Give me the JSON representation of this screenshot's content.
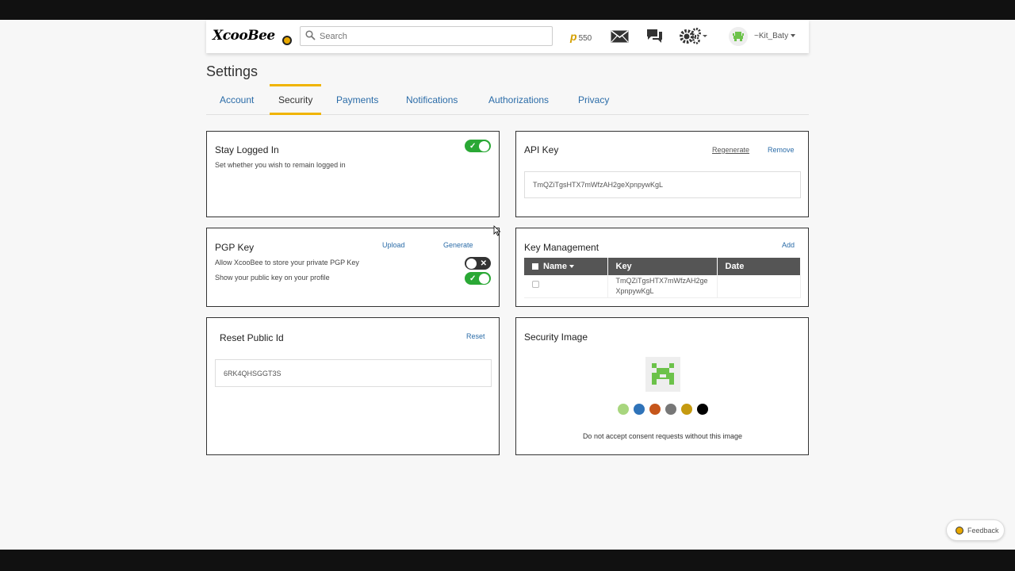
{
  "header": {
    "logo_text": "XcooBee",
    "search_placeholder": "Search",
    "points_symbol": "p",
    "points_value": "550",
    "username": "~Kit_Baty",
    "icons": [
      "search-icon",
      "mail-icon",
      "chat-icon",
      "gears-icon",
      "avatar-icon"
    ]
  },
  "page": {
    "title": "Settings"
  },
  "tabs": [
    {
      "label": "Account"
    },
    {
      "label": "Security"
    },
    {
      "label": "Payments"
    },
    {
      "label": "Notifications"
    },
    {
      "label": "Authorizations"
    },
    {
      "label": "Privacy"
    }
  ],
  "active_tab": "Security",
  "stay_logged_in": {
    "title": "Stay Logged In",
    "subtitle": "Set whether you wish to remain logged in",
    "enabled": true
  },
  "api_key": {
    "title": "API Key",
    "regenerate_label": "Regenerate",
    "remove_label": "Remove",
    "value": "TmQZiTgsHTX7mWfzAH2geXpnpywKgL"
  },
  "pgp_key": {
    "title": "PGP Key",
    "upload_label": "Upload",
    "generate_label": "Generate",
    "option1_label": "Allow XcooBee to store your private PGP Key",
    "option1_enabled": false,
    "option2_label": "Show your public key on your profile",
    "option2_enabled": true
  },
  "key_management": {
    "title": "Key Management",
    "add_label": "Add",
    "columns": [
      "Name",
      "Key",
      "Date"
    ],
    "rows": [
      {
        "name": "",
        "key_line1": "TmQZiTgsHTX7mWfzAH2ge",
        "key_line2": "XpnpywKgL",
        "date": ""
      }
    ]
  },
  "reset_public_id": {
    "title": "Reset Public Id",
    "reset_label": "Reset",
    "value": "6RK4QHSGGT3S"
  },
  "security_image": {
    "title": "Security Image",
    "note": "Do not accept consent requests without this image",
    "swatch_colors": [
      "#a8d67e",
      "#2f73b9",
      "#c6561b",
      "#777777",
      "#c59a10",
      "#000000"
    ]
  },
  "feedback": {
    "label": "Feedback"
  },
  "colors": {
    "link": "#2b6ca8",
    "accent": "#f0b400",
    "toggle_on": "#2aa835",
    "table_header": "#555555"
  }
}
